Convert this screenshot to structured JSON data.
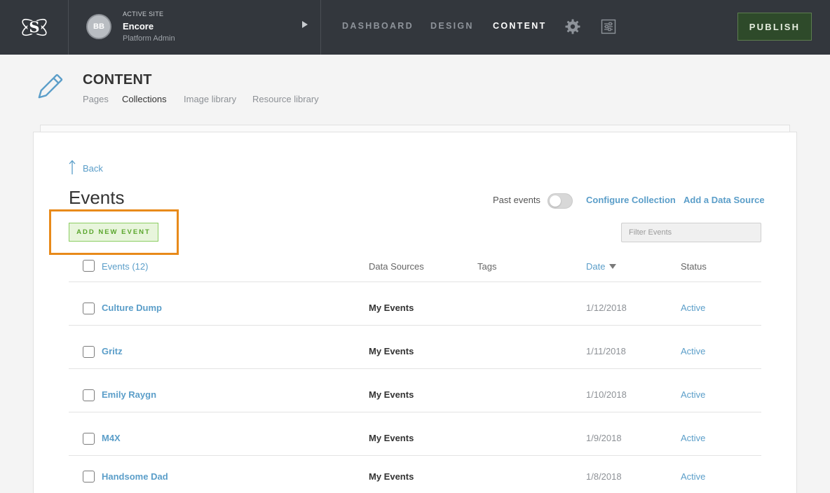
{
  "topbar": {
    "logo_letter": "S",
    "site": {
      "avatar_initials": "BB",
      "kicker": "ACTIVE SITE",
      "name": "Encore",
      "role": "Platform Admin"
    },
    "nav": {
      "dashboard": "DASHBOARD",
      "design": "DESIGN",
      "content": "CONTENT"
    },
    "icons": [
      "gear-icon",
      "sliders-icon"
    ],
    "publish_label": "PUBLISH"
  },
  "page": {
    "title": "CONTENT",
    "subnav": [
      "Pages",
      "Collections",
      "Image library",
      "Resource library"
    ],
    "active_subnav": "Collections"
  },
  "collection": {
    "back_label": "Back",
    "title": "Events",
    "past_events_label": "Past events",
    "past_events_on": false,
    "configure_label": "Configure Collection",
    "add_source_label": "Add a Data Source",
    "add_button_label": "ADD NEW EVENT",
    "filter_placeholder": "Filter Events",
    "columns": {
      "name": "Events (12)",
      "sources": "Data Sources",
      "tags": "Tags",
      "date": "Date",
      "status": "Status"
    },
    "rows": [
      {
        "name": "Culture Dump",
        "source": "My Events",
        "tags": "",
        "date": "1/12/2018",
        "status": "Active"
      },
      {
        "name": "Gritz",
        "source": "My Events",
        "tags": "",
        "date": "1/11/2018",
        "status": "Active"
      },
      {
        "name": "Emily Raygn",
        "source": "My Events",
        "tags": "",
        "date": "1/10/2018",
        "status": "Active"
      },
      {
        "name": "M4X",
        "source": "My Events",
        "tags": "",
        "date": "1/9/2018",
        "status": "Active"
      },
      {
        "name": "Handsome Dad",
        "source": "My Events",
        "tags": "",
        "date": "1/8/2018",
        "status": "Active"
      }
    ]
  },
  "colors": {
    "topbar": "#33373d",
    "link": "#5b9ec9",
    "highlight": "#e88a1a",
    "add_button_text": "#5aa62c",
    "publish_bg": "#2e4a2a"
  }
}
